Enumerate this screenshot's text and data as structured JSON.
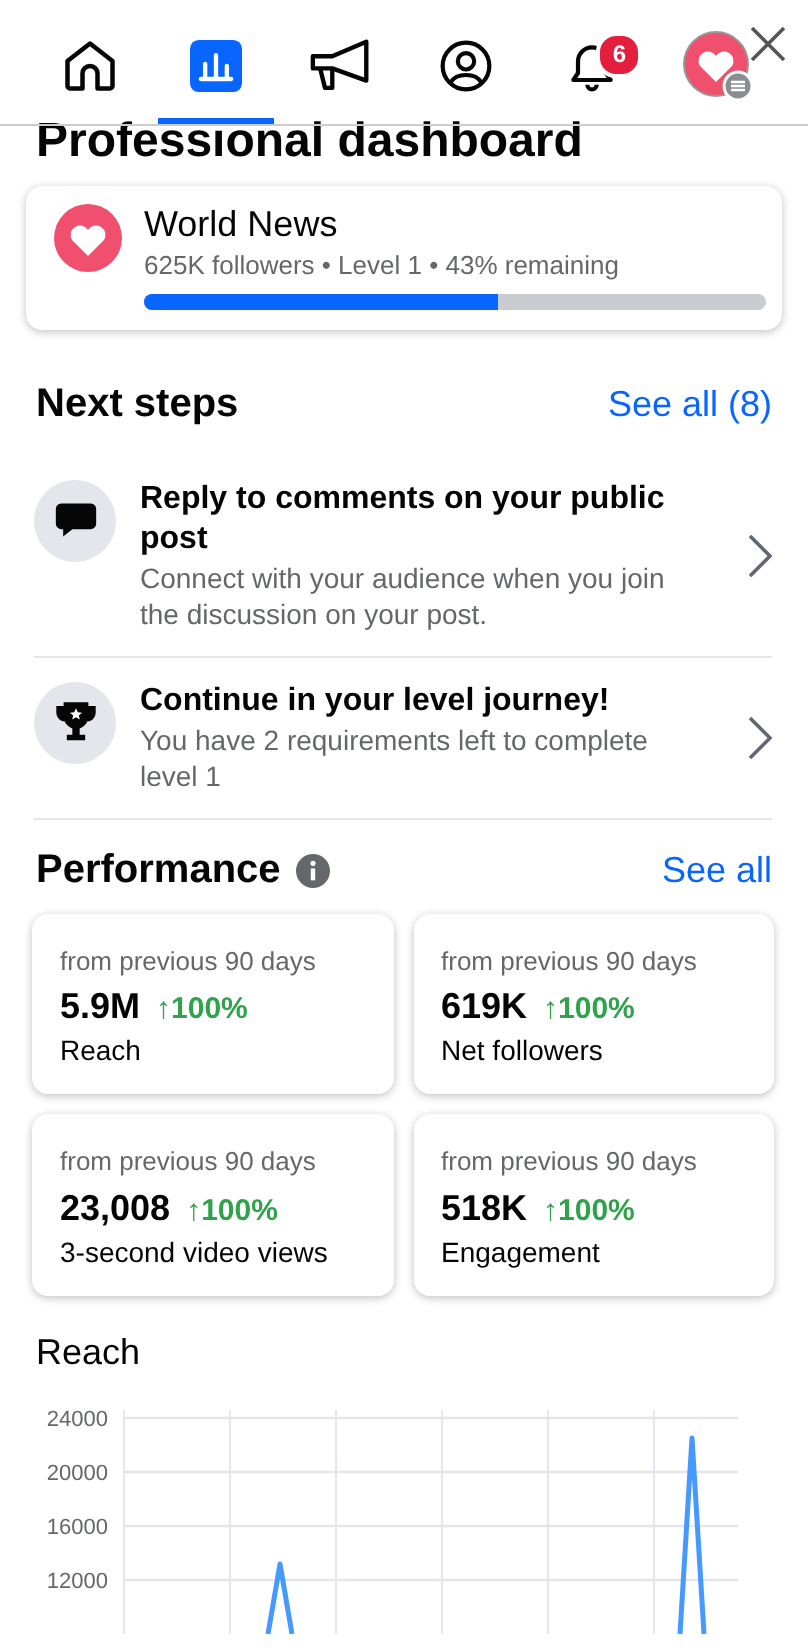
{
  "nav_tabs": [
    {
      "selected": false
    },
    {
      "selected": true
    },
    {
      "selected": false
    },
    {
      "selected": false
    },
    {
      "selected": false,
      "badge": "6"
    },
    {
      "selected": false
    }
  ],
  "title": "Professional dashboard",
  "page": {
    "name": "World News",
    "stats": "625K followers • Level 1 • 43% remaining",
    "level": 0.57
  },
  "next_steps": {
    "heading": "Next steps",
    "see_all": "See all (8)",
    "items": [
      {
        "title": "Reply to comments on your public post",
        "description": "Connect with your audience when you join the discussion on your post."
      },
      {
        "title": "Continue in your level journey!",
        "description": "You have 2 requirements left to complete level 1"
      }
    ]
  },
  "performance": {
    "heading": "Performance",
    "see_all": "See all",
    "metrics": [
      {
        "period": "from previous 90 days",
        "value": "5.9M",
        "change": "↑100%",
        "label": "Reach"
      },
      {
        "period": "from previous 90 days",
        "value": "619K",
        "change": "↑100%",
        "label": "Net followers"
      },
      {
        "period": "from previous 90 days",
        "value": "23,008",
        "change": "↑100%",
        "label": "3-second video views"
      },
      {
        "period": "from previous 90 days",
        "value": "518K",
        "change": "↑100%",
        "label": "Engagement"
      }
    ]
  },
  "reach": {
    "heading": "Reach",
    "y_axis_labels": [
      "24000",
      "20000",
      "16000",
      "12000"
    ]
  }
}
